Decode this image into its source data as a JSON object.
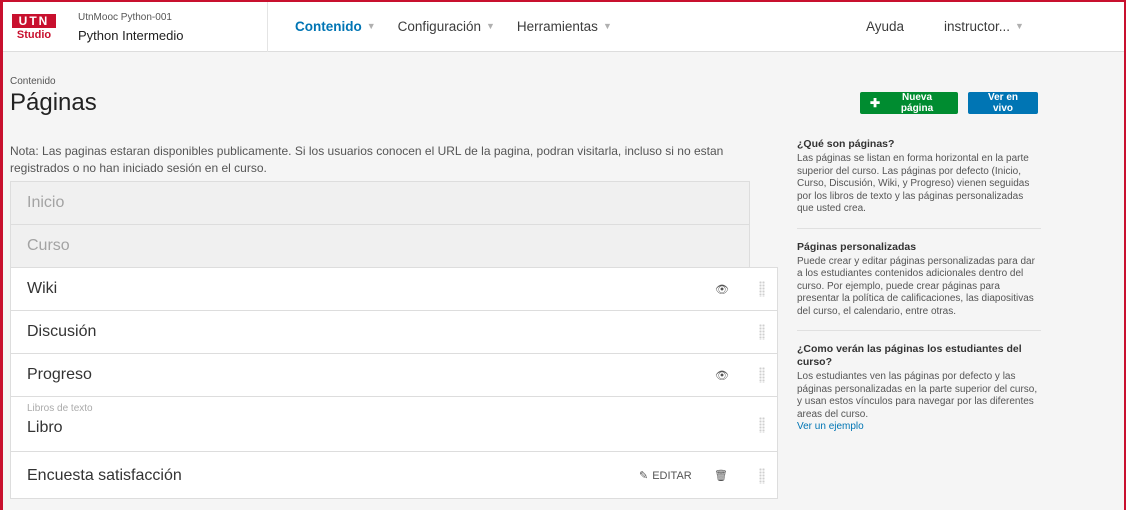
{
  "header": {
    "logo_top": "UTN",
    "logo_bottom": "Studio",
    "course_org": "UtnMooc Python-001",
    "course_name": "Python Intermedio",
    "nav": [
      {
        "label": "Contenido",
        "active": true
      },
      {
        "label": "Configuración",
        "active": false
      },
      {
        "label": "Herramientas",
        "active": false
      }
    ],
    "help_label": "Ayuda",
    "user_label": "instructor..."
  },
  "page": {
    "subtitle": "Contenido",
    "title": "Páginas",
    "new_page_label": "Nueva página",
    "view_live_label": "Ver en vivo",
    "note": "Nota: Las paginas estaran disponibles publicamente. Si los usuarios conocen el URL de la pagina, podran visitarla, incluso si no estan registrados o no han iniciado sesión en el curso."
  },
  "pages": {
    "inicio": "Inicio",
    "curso": "Curso",
    "wiki": "Wiki",
    "discusion": "Discusión",
    "progreso": "Progreso",
    "libros_sub": "Libros de texto",
    "libro": "Libro",
    "encuesta": "Encuesta satisfacción",
    "edit_label": "EDITAR"
  },
  "sidebar": {
    "s1_title": "¿Qué son páginas?",
    "s1_text": "Las páginas se listan en forma horizontal en la parte superior del curso. Las páginas por defecto (Inicio, Curso, Discusión, Wiki, y Progreso) vienen seguidas por los libros de texto y las páginas personalizadas que usted crea.",
    "s2_title": "Páginas personalizadas",
    "s2_text": "Puede crear y editar páginas personalizadas para dar a los estudiantes contenidos adicionales dentro del curso. Por ejemplo, puede crear páginas para presentar la política de calificaciones, las diapositivas del curso, el calendario, entre otras.",
    "s3_title": "¿Como verán las páginas los estudiantes del curso?",
    "s3_text": "Los estudiantes ven las páginas por defecto y las páginas personalizadas en la parte superior del curso, y usan estos vínculos para navegar por las diferentes areas del curso.",
    "s3_link": "Ver un ejemplo"
  },
  "colors": {
    "accent_blue": "#0075b4",
    "accent_green": "#008c30",
    "brand_red": "#c8102e"
  }
}
